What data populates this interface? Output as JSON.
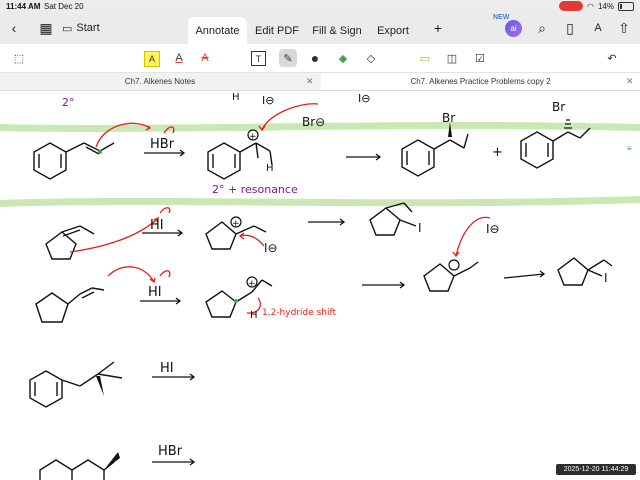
{
  "status_bar": {
    "time": "11:44 AM",
    "date": "Sat Dec 20",
    "battery": "14%"
  },
  "toolbar": {
    "start_label": "Start",
    "tabs": [
      {
        "label": "Annotate",
        "active": true
      },
      {
        "label": "Edit PDF",
        "active": false
      },
      {
        "label": "Fill & Sign",
        "active": false
      },
      {
        "label": "Export",
        "active": false
      }
    ],
    "new_badge": "NEW",
    "ai_label": "ai",
    "add_icon": "plus-icon",
    "right_icons": [
      "search-icon",
      "book-icon",
      "text-size-icon",
      "share-icon"
    ]
  },
  "annotate_tools": {
    "icons": [
      "select-icon",
      "highlight-icon",
      "text-color-icon",
      "strikethrough-icon",
      "text-box-icon",
      "pen-icon",
      "dot-icon",
      "marker-icon",
      "eraser-icon",
      "comment-icon",
      "shapes-icon",
      "stamp-icon",
      "undo-icon"
    ],
    "highlight_glyph": "A",
    "text_glyph": "A",
    "strike_glyph": "A",
    "textbox_glyph": "T"
  },
  "document_tabs": [
    {
      "label": "Ch7. Alkenes Notes",
      "active": false
    },
    {
      "label": "Ch7. Alkenes Practice Problems copy 2",
      "active": true
    }
  ],
  "annotations": {
    "top_2deg": "2°",
    "top_h": "H",
    "top_iminus": "I⊖",
    "top_iminus2": "I⊖",
    "hbr_1": "HBr",
    "br_minus": "Br⊖",
    "h_label": "H",
    "plus_1": "+",
    "br_1": "Br",
    "br_2": "Br",
    "plus_sign": "+",
    "resonance": "2° + resonance",
    "hi_1": "HI",
    "iminus_1": "I⊖",
    "i_prod_1": "I",
    "iminus_2": "I⊖",
    "hi_2": "HI",
    "plus_2": "+",
    "hydride_h": "H",
    "hydride_text": "1,2-hydride shift",
    "i_prod_2": "I",
    "plus_3": "+",
    "hi_3": "HI",
    "hbr_2": "HBr"
  },
  "colors": {
    "accent_blue": "#3a78d8",
    "recording_red": "#e53935",
    "arrow_red": "#e0201a",
    "purple_ink": "#7a1a8c",
    "green_band": "#b9df9a",
    "highlighter_yellow": "#fff25a"
  },
  "timestamp": "2025-12-20 11:44:29"
}
